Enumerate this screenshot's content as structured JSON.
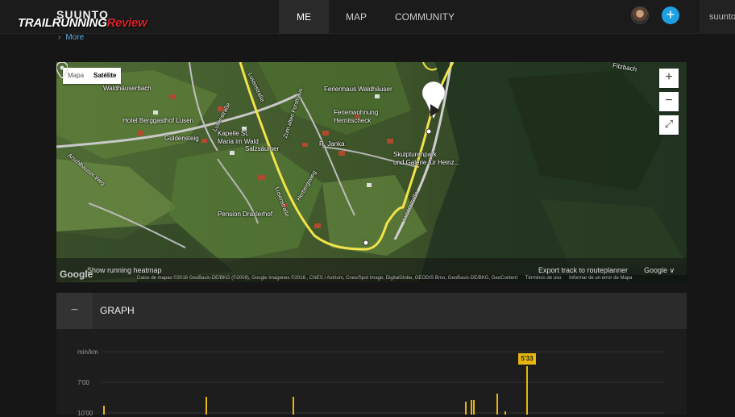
{
  "brand": {
    "logo": "SUUNTO",
    "watermark_main": "TRAILRUNNING",
    "watermark_accent": "Review"
  },
  "nav": {
    "me": "ME",
    "map": "MAP",
    "community": "COMMUNITY",
    "user": "suunto."
  },
  "actions": {
    "add": "+"
  },
  "more_link": "More",
  "map": {
    "type_buttons": [
      "Mapa",
      "Satélite"
    ],
    "active_type": "Satélite",
    "zoom_in": "+",
    "zoom_out": "−",
    "fullscreen": "⤢",
    "heatmap_toggle": "Show running heatmap",
    "export": "Export track to routeplanner",
    "provider": "Google",
    "provider_dropdown": "Google ∨",
    "attribution": [
      "Datos de mapas ©2016 GeoBasis-DE/BKG (©2009), Google Imágenes ©2016 , CNES / Astrium, Cnes/Spot Image, DigitalGlobe, GEODIS Brno, GeoBasis-DE/BKG, GeoContent",
      "Términos de uso",
      "Informar de un error de Mapa"
    ],
    "labels": {
      "waldhauserbach": "Waldhäuserbach",
      "fitzbach": "Fitzbach",
      "hotel": "Hotel Berggasthof Lusen",
      "guldensteig": "Guldensteig",
      "kapelle": "Kapelle St.\nMaria im Wald",
      "ferienhaus": "Ferienhaus Waldhäuser",
      "ferienwohnung": "Ferienwohnung\nHernitscheck",
      "zumalten": "Zum alten Forsthaus",
      "salzsaumer": "Salzsäumer",
      "janka": "R. Janka",
      "skulptur": "Skulpturenpark\nund Galerie für Heinz...",
      "lusenstrasse1": "Lusenstraße",
      "lusenstrasse2": "Lusenstraße",
      "lusenstrasse3": "Lusenstraße",
      "lusenstrasse4": "Lusenstraße",
      "herbergsweg": "Herbergsweg",
      "pension": "Pension Draxlerhof",
      "weg": "Arschlhauser-Weg"
    }
  },
  "graph": {
    "collapse": "−",
    "title": "GRAPH",
    "unit": "min/km",
    "ticks": [
      "7'00",
      "10'00"
    ],
    "tooltip": "5'33"
  },
  "colors": {
    "accent": "#e7b60d",
    "plus": "#1ea0e0",
    "track": "#f2e34a"
  },
  "chart_data": {
    "type": "bar",
    "ylabel": "min/km",
    "y_ticks": [
      "7'00",
      "10'00"
    ],
    "highlight": "5'33"
  }
}
